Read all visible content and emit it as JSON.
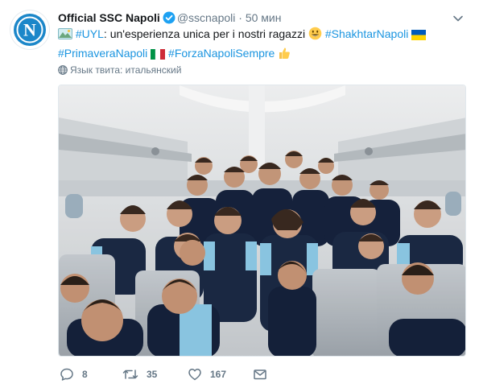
{
  "author": {
    "name": "Official SSC Napoli",
    "handle": "@sscnapoli",
    "separator": "·",
    "time": "50 мин"
  },
  "tweet": {
    "part1": " #UYL",
    "part2": ": un'esperienza unica per i nostri ragazzi ",
    "tag1": " #ShakhtarNapoli",
    "tag2": "#PrimaveraNapoli",
    "tag3": " #ForzaNapoliSempre"
  },
  "language_label": "Язык твита: итальянский",
  "actions": {
    "reply_count": "8",
    "retweet_count": "35",
    "like_count": "167"
  },
  "colors": {
    "link": "#1b95e0",
    "muted": "#657786",
    "verified": "#1da1f2"
  },
  "icons": [
    "verified-icon",
    "chevron-down-icon",
    "globe-icon",
    "reply-icon",
    "retweet-icon",
    "heart-icon",
    "envelope-icon"
  ]
}
